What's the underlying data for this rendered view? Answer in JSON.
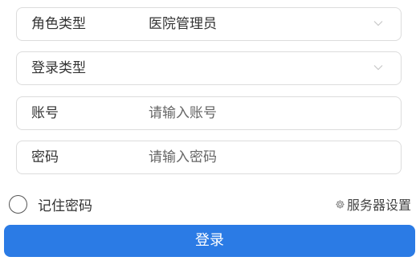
{
  "form": {
    "role_type": {
      "label": "角色类型",
      "value": "医院管理员"
    },
    "login_type": {
      "label": "登录类型",
      "value": ""
    },
    "account": {
      "label": "账号",
      "placeholder": "请输入账号",
      "value": ""
    },
    "password": {
      "label": "密码",
      "placeholder": "请输入密码",
      "value": ""
    },
    "remember_password": {
      "label": "记住密码",
      "checked": false
    },
    "server_settings": {
      "label": "服务器设置",
      "icon": "gear-icon"
    },
    "login_button": {
      "label": "登录"
    }
  },
  "colors": {
    "primary": "#2b7be5",
    "field_border": "#dcdcdc",
    "text": "#333333",
    "placeholder": "#666666"
  }
}
